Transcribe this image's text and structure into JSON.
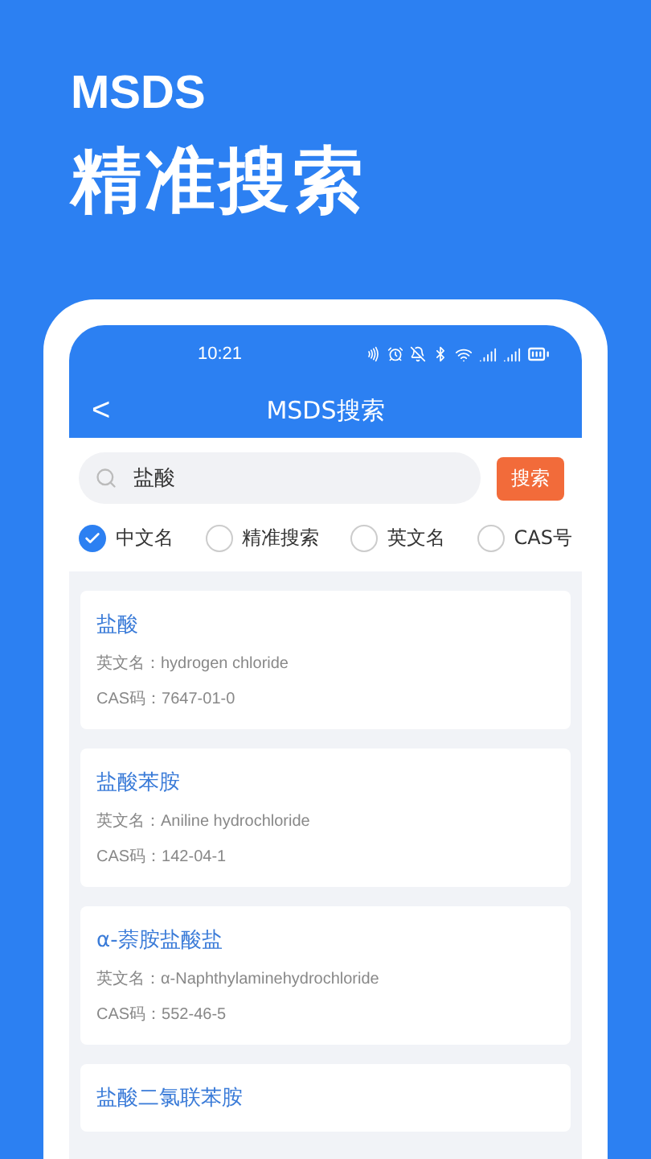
{
  "promo": {
    "subtitle": "MSDS",
    "headline": "精准搜索"
  },
  "status_bar": {
    "time": "10:21"
  },
  "nav": {
    "back": "<",
    "title": "MSDS搜索"
  },
  "search": {
    "value": "盐酸",
    "button": "搜索"
  },
  "options": [
    {
      "label": "中文名",
      "selected": true
    },
    {
      "label": "精准搜索",
      "selected": false
    },
    {
      "label": "英文名",
      "selected": false
    },
    {
      "label": "CAS号",
      "selected": false
    }
  ],
  "results": [
    {
      "name": "盐酸",
      "english": "英文名：hydrogen chloride",
      "cas": "CAS码：7647-01-0"
    },
    {
      "name": "盐酸苯胺",
      "english": "英文名：Aniline hydrochloride",
      "cas": "CAS码：142-04-1"
    },
    {
      "name": "α-萘胺盐酸盐",
      "english": "英文名：α-Naphthylaminehydrochloride",
      "cas": "CAS码：552-46-5"
    },
    {
      "name": "盐酸二氯联苯胺"
    }
  ]
}
